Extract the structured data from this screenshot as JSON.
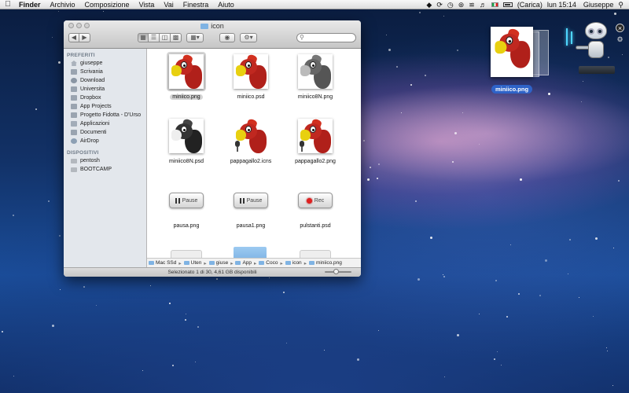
{
  "menubar": {
    "app": "Finder",
    "items": [
      "Archivio",
      "Composizione",
      "Vista",
      "Vai",
      "Finestra",
      "Aiuto"
    ],
    "battery": "(Carica)",
    "clock": "lun 15:14",
    "user": "Giuseppe"
  },
  "window": {
    "title": "icon",
    "search_placeholder": ""
  },
  "sidebar": {
    "favorites_header": "PREFERITI",
    "favorites": [
      {
        "label": "giuseppe",
        "icon": "home-icon"
      },
      {
        "label": "Scrivania",
        "icon": "folder-icon"
      },
      {
        "label": "Download",
        "icon": "download-icon"
      },
      {
        "label": "Universita",
        "icon": "folder-icon"
      },
      {
        "label": "Dropbox",
        "icon": "folder-icon"
      },
      {
        "label": "App Projects",
        "icon": "folder-icon"
      },
      {
        "label": "Progetto Fidotta - D'Urso",
        "icon": "folder-icon"
      },
      {
        "label": "Applicazioni",
        "icon": "applications-icon"
      },
      {
        "label": "Documenti",
        "icon": "folder-icon"
      },
      {
        "label": "AirDrop",
        "icon": "airdrop-icon"
      }
    ],
    "devices_header": "DISPOSITIVI",
    "devices": [
      {
        "label": "pentosh",
        "icon": "disk-icon"
      },
      {
        "label": "BOOTCAMP",
        "icon": "disk-icon"
      }
    ]
  },
  "files": [
    {
      "name": "miniico.png",
      "kind": "parrot-color",
      "selected": true
    },
    {
      "name": "miniico.psd",
      "kind": "parrot-color"
    },
    {
      "name": "miniico8N.png",
      "kind": "parrot-bw"
    },
    {
      "name": "miniico8N.psd",
      "kind": "parrot-dark"
    },
    {
      "name": "pappagallo2.icns",
      "kind": "parrot-mic"
    },
    {
      "name": "pappagallo2.png",
      "kind": "parrot-mic-framed"
    },
    {
      "name": "pausa.png",
      "kind": "pause-button",
      "button_text": "Pause"
    },
    {
      "name": "pausa1.png",
      "kind": "pause-button-dark",
      "button_text": "Pause"
    },
    {
      "name": "pulstanti.psd",
      "kind": "rec-button",
      "button_text": "Rec"
    }
  ],
  "pathbar": [
    "Mac SSd",
    "Uten",
    "giuse",
    "App",
    "Coco",
    "icon",
    "miniico.png"
  ],
  "statusbar": {
    "text": "Selezionato 1 di 30, 4,61 GB disponibili",
    "zoom_level": 0.4
  },
  "desktop": {
    "drag_item_label": "miniico.png"
  },
  "colors": {
    "selection_blue": "#2e63c8",
    "parrot_red": "#b0201a",
    "parrot_yellow": "#e8d010"
  }
}
